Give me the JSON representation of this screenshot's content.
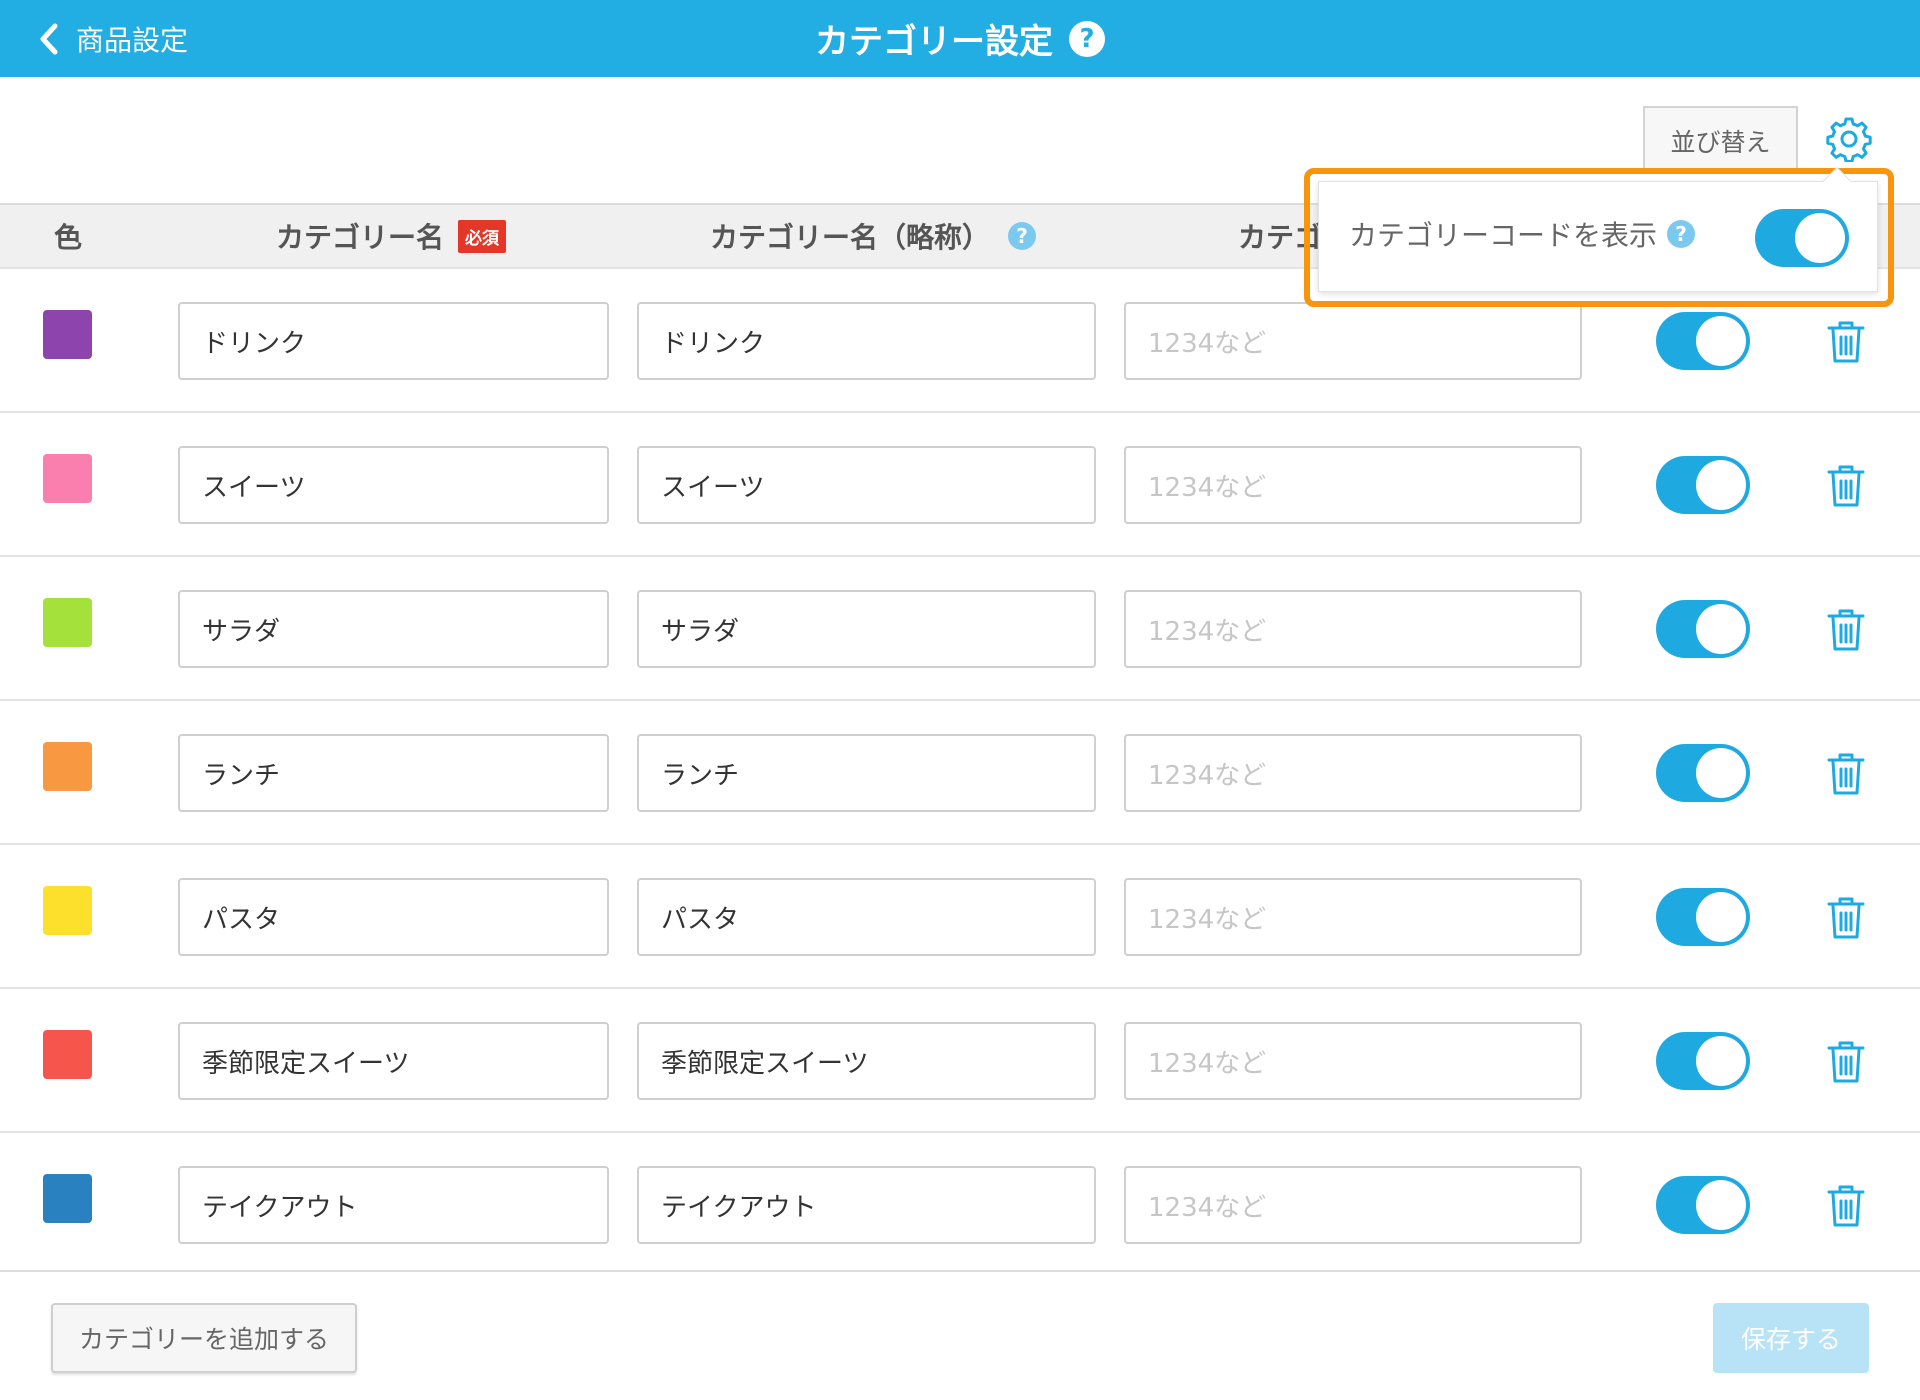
{
  "header": {
    "back_label": "商品設定",
    "title": "カテゴリー設定",
    "help_icon": "?",
    "bg_color": "#22ade3"
  },
  "toolbar": {
    "sort_label": "並び替え",
    "settings_icon": "gear-icon"
  },
  "table": {
    "headers": {
      "color": "色",
      "name": "カテゴリー名",
      "required_badge": "必須",
      "short_name": "カテゴリー名（略称）",
      "code": "カテゴ"
    },
    "code_placeholder": "1234など",
    "rows": [
      {
        "color": "#8e44ad",
        "name": "ドリンク",
        "short_name": "ドリンク",
        "code": "",
        "visible": true
      },
      {
        "color": "#fb7fae",
        "name": "スイーツ",
        "short_name": "スイーツ",
        "code": "",
        "visible": true
      },
      {
        "color": "#a4e13a",
        "name": "サラダ",
        "short_name": "サラダ",
        "code": "",
        "visible": true
      },
      {
        "color": "#f89941",
        "name": "ランチ",
        "short_name": "ランチ",
        "code": "",
        "visible": true
      },
      {
        "color": "#fde02b",
        "name": "パスタ",
        "short_name": "パスタ",
        "code": "",
        "visible": true
      },
      {
        "color": "#f5554b",
        "name": "季節限定スイーツ",
        "short_name": "季節限定スイーツ",
        "code": "",
        "visible": true
      },
      {
        "color": "#2981c0",
        "name": "テイクアウト",
        "short_name": "テイクアウト",
        "code": "",
        "visible": true
      }
    ]
  },
  "popover": {
    "label": "カテゴリーコードを表示",
    "help_icon": "?",
    "toggle_on": true,
    "highlight_color": "#f7950f"
  },
  "footer": {
    "add_label": "カテゴリーを追加する",
    "save_label": "保存する"
  }
}
